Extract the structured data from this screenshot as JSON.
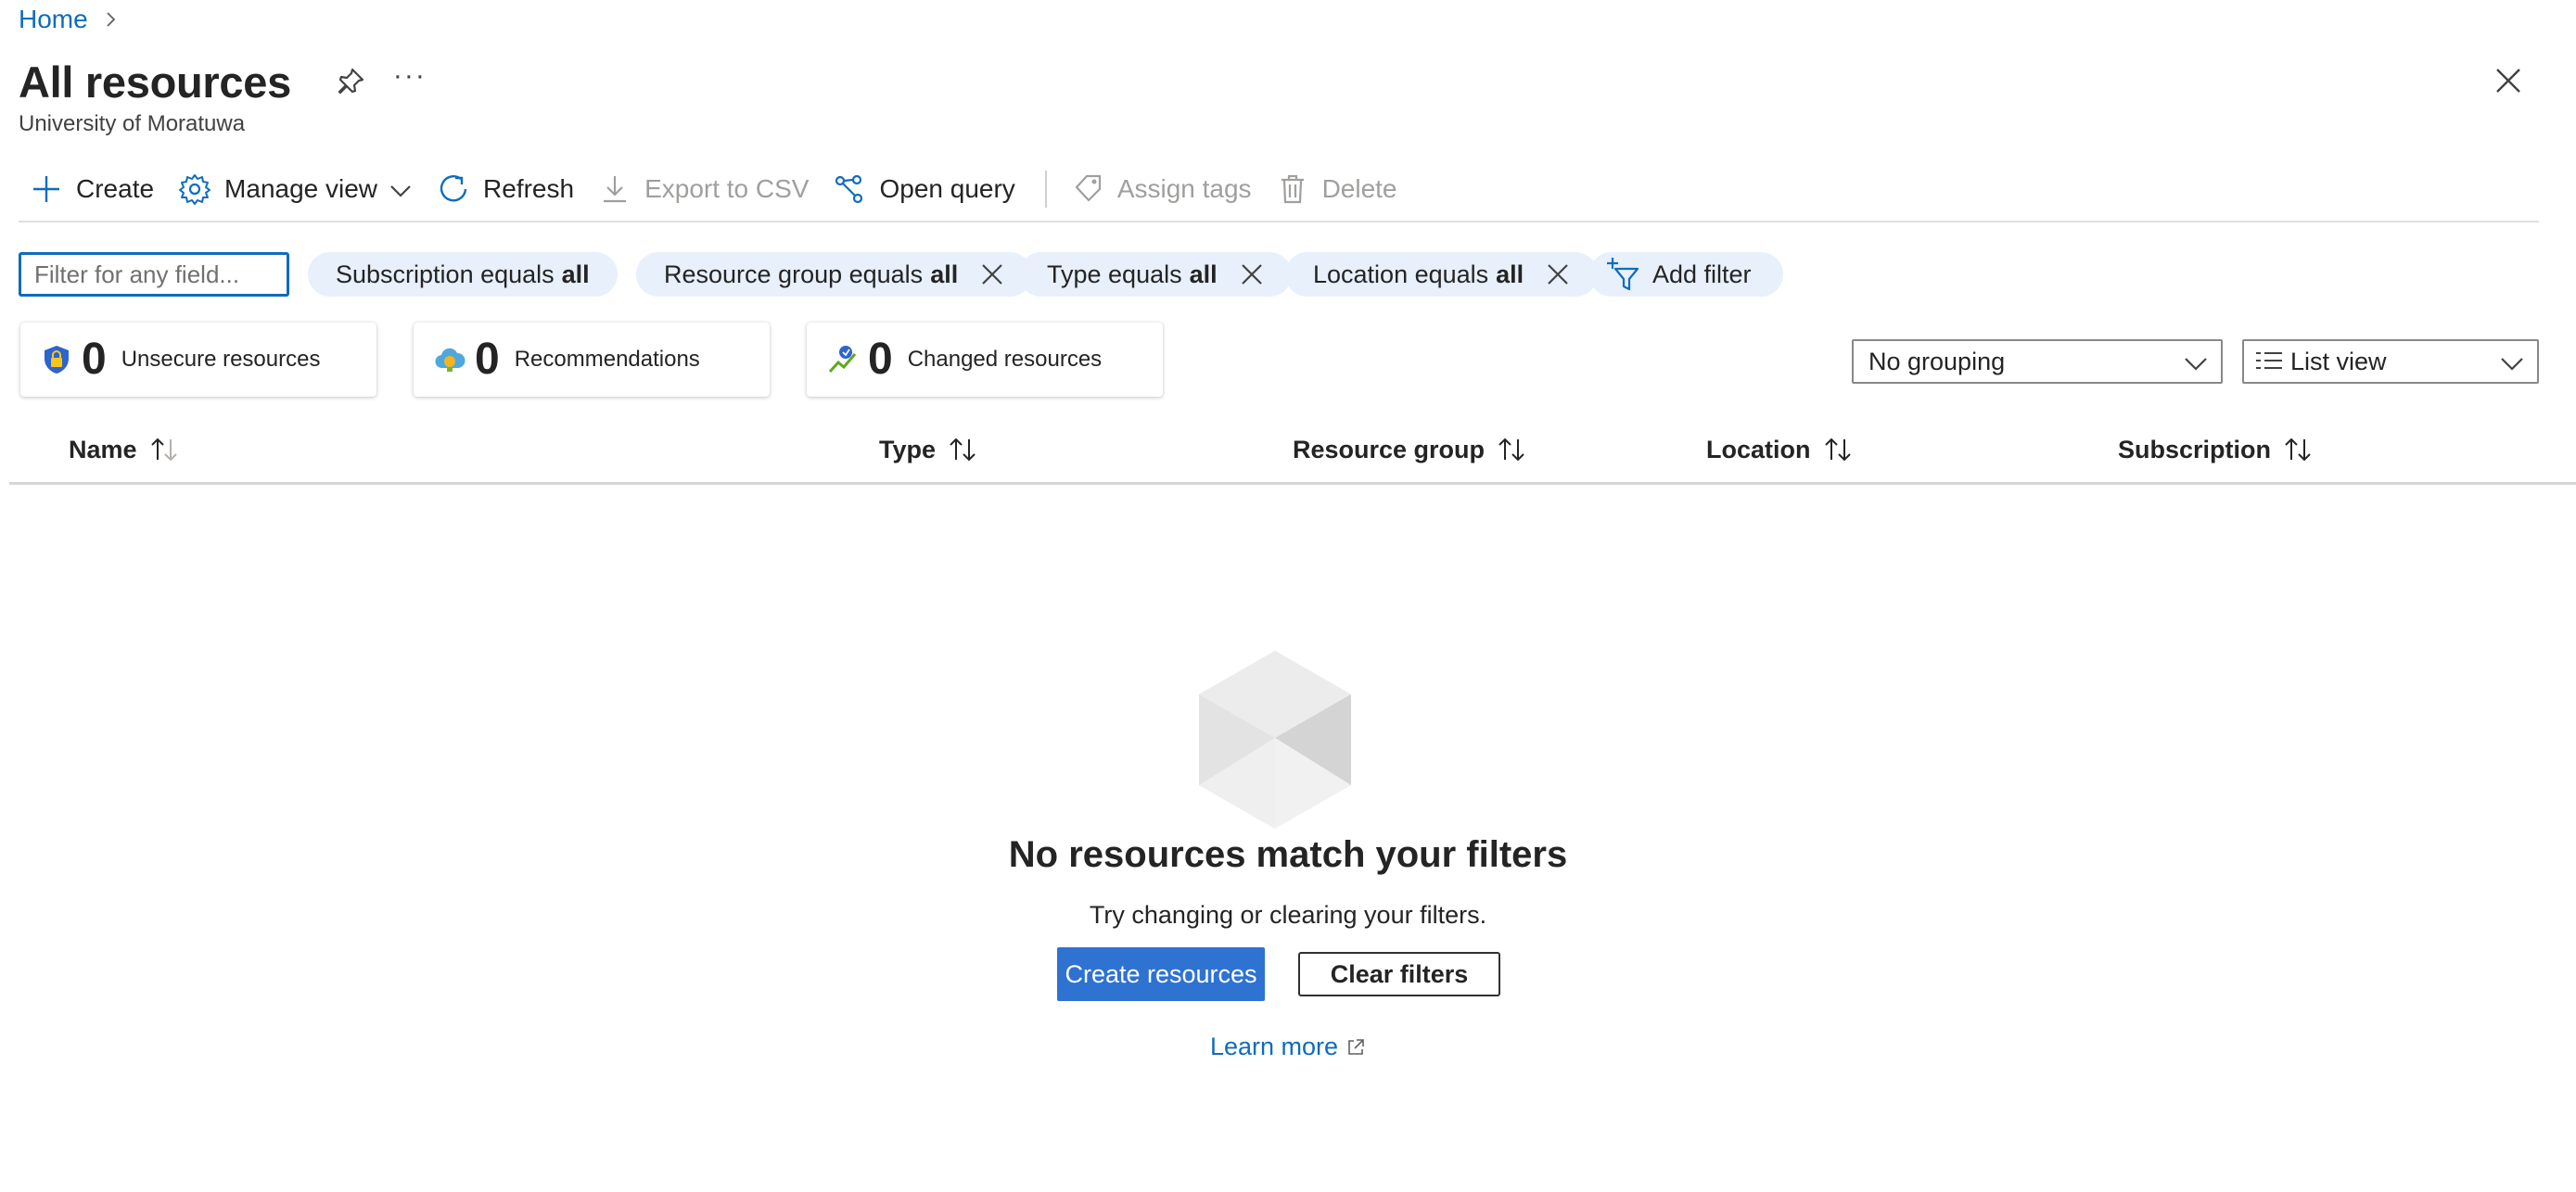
{
  "breadcrumb": {
    "home": "Home"
  },
  "header": {
    "title": "All resources",
    "subtitle": "University of Moratuwa",
    "more_glyph": "···"
  },
  "toolbar": {
    "create": "Create",
    "manage_view": "Manage view",
    "refresh": "Refresh",
    "export_csv": "Export to CSV",
    "open_query": "Open query",
    "assign_tags": "Assign tags",
    "delete": "Delete"
  },
  "filters": {
    "placeholder": "Filter for any field...",
    "pills": [
      {
        "label": "Subscription equals",
        "value": "all"
      },
      {
        "label": "Resource group equals",
        "value": "all"
      },
      {
        "label": "Type equals",
        "value": "all"
      },
      {
        "label": "Location equals",
        "value": "all"
      }
    ],
    "add_filter": "Add filter"
  },
  "summary": [
    {
      "count": "0",
      "label": "Unsecure resources",
      "icon": "shield-lock-icon"
    },
    {
      "count": "0",
      "label": "Recommendations",
      "icon": "cloud-advisor-icon"
    },
    {
      "count": "0",
      "label": "Changed resources",
      "icon": "change-tracking-icon"
    }
  ],
  "view_controls": {
    "grouping": "No grouping",
    "view": "List view"
  },
  "table": {
    "columns": [
      "Name",
      "Type",
      "Resource group",
      "Location",
      "Subscription"
    ]
  },
  "empty_state": {
    "icon": "empty-cube-icon",
    "title": "No resources match your filters",
    "subtitle": "Try changing or clearing your filters.",
    "primary_button": "Create resources",
    "secondary_button": "Clear filters",
    "learn_more": "Learn more"
  },
  "colors": {
    "accent": "#0f6cbd",
    "primary_button": "#2e72d2",
    "pill_background": "#e7f0fb",
    "disabled_text": "#a19f9d"
  }
}
